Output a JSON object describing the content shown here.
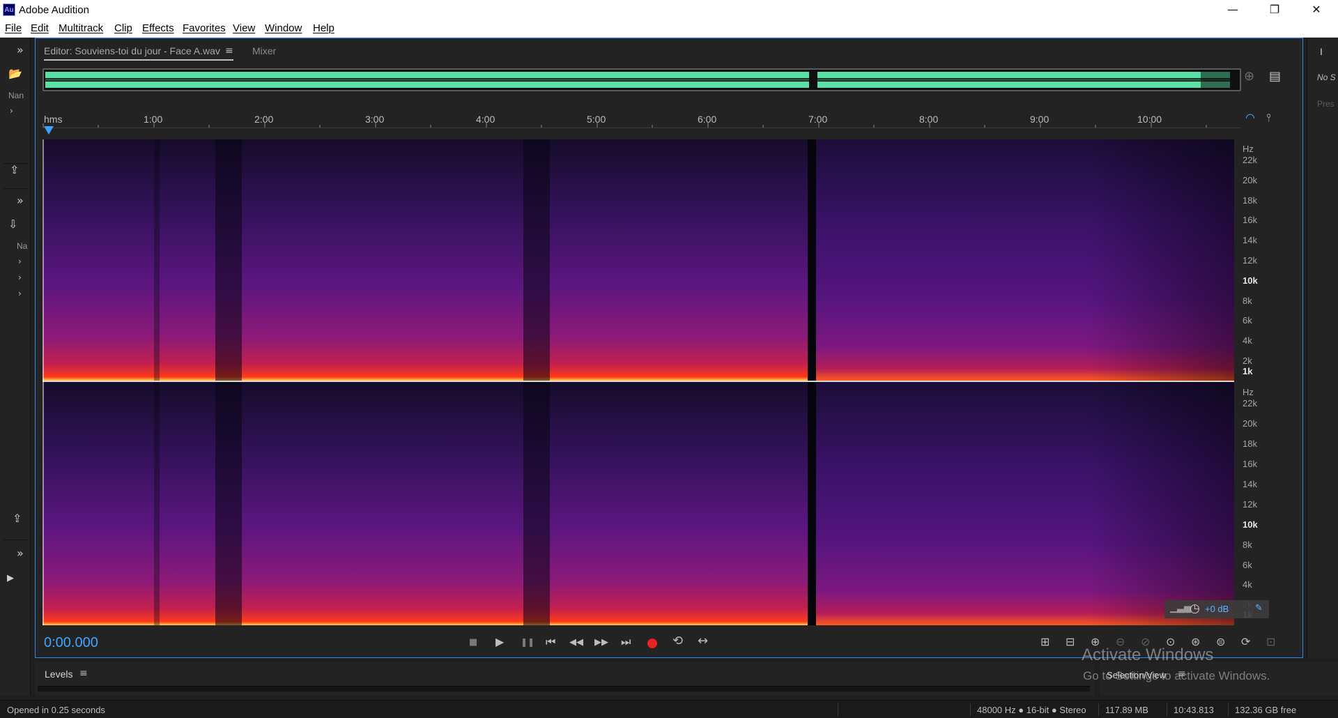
{
  "app": {
    "logo": "Au",
    "title": "Adobe Audition"
  },
  "window_controls": {
    "minimize": "—",
    "restore": "❐",
    "close": "✕"
  },
  "menu": [
    "File",
    "Edit",
    "Multitrack",
    "Clip",
    "Effects",
    "Favorites",
    "View",
    "Window",
    "Help"
  ],
  "left_panel": {
    "expand_icon": "»",
    "folder_icon": "📂",
    "name_label": "Nan",
    "import_icon": "⇩",
    "na_label": "Na",
    "chevron": "›",
    "export_icon": "⇪",
    "play_icon": "▶"
  },
  "editor": {
    "tab_label": "Editor: Souviens-toi du jour - Face A.wav",
    "tab_menu_icon": "≡",
    "mixer_label": "Mixer",
    "ruler": {
      "unit": "hms",
      "labels": [
        "1:00",
        "2:00",
        "3:00",
        "4:00",
        "5:00",
        "6:00",
        "7:00",
        "8:00",
        "9:00",
        "10:00"
      ],
      "duration_seconds": 643.8
    },
    "freq_axis": {
      "unit": "Hz",
      "labels": [
        "22k",
        "20k",
        "18k",
        "16k",
        "14k",
        "12k",
        "10k",
        "8k",
        "6k",
        "4k",
        "2k",
        "1k"
      ]
    },
    "hud_gain": "+0 dB",
    "timecode": "0:00.000",
    "transport": {
      "stop": "■",
      "play": "▶",
      "pause": "❚❚",
      "to_start": "⏮",
      "rewind": "◀◀",
      "fast_forward": "▶▶",
      "to_end": "⏭",
      "loop": "⟲",
      "skip": "↔"
    },
    "colors": {
      "accent": "#2d8ceb",
      "waveform": "#58e0a6",
      "timecode": "#3fa6ff",
      "record": "#e52323"
    }
  },
  "right_panel": {
    "top_label": "I",
    "no_label": "No S",
    "pres_label": "Pres"
  },
  "levels_panel": {
    "title": "Levels",
    "menu_icon": "≡"
  },
  "selection_view": {
    "title": "Selection/View",
    "menu_icon": "≡"
  },
  "watermark": {
    "line1": "Activate Windows",
    "line2": "Go to Settings to activate Windows."
  },
  "status": {
    "message": "Opened in 0.25 seconds",
    "format": "48000 Hz ● 16-bit ● Stereo",
    "size": "117.89 MB",
    "duration": "10:43.813",
    "free": "132.36 GB free"
  }
}
